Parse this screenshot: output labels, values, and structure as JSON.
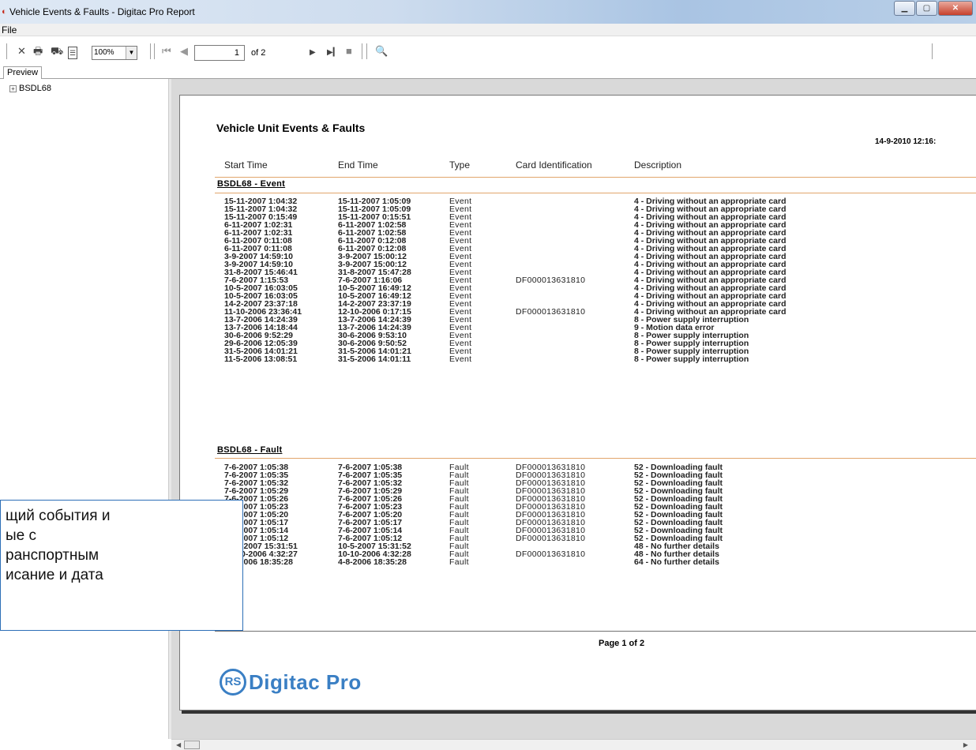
{
  "window": {
    "title": "Vehicle Events & Faults - Digitac Pro Report"
  },
  "menu": {
    "file": "File"
  },
  "toolbar": {
    "zoom": "100%",
    "page_current": "1",
    "page_of": "of 2"
  },
  "tabs": {
    "preview": "Preview"
  },
  "tree": {
    "root": "BSDL68"
  },
  "report": {
    "title": "Vehicle Unit Events & Faults",
    "date": "14-9-2010  12:16:",
    "headers": {
      "start": "Start Time",
      "end": "End Time",
      "type": "Type",
      "card": "Card Identification",
      "description": "Description"
    },
    "events_section": "BSDL68 - Event",
    "events": [
      [
        "15-11-2007  1:04:32",
        "15-11-2007  1:05:09",
        "Event",
        "",
        "4 - Driving without an appropriate card"
      ],
      [
        "15-11-2007  1:04:32",
        "15-11-2007  1:05:09",
        "Event",
        "",
        "4 - Driving without an appropriate card"
      ],
      [
        "15-11-2007  0:15:49",
        "15-11-2007  0:15:51",
        "Event",
        "",
        "4 - Driving without an appropriate card"
      ],
      [
        "6-11-2007  1:02:31",
        "6-11-2007  1:02:58",
        "Event",
        "",
        "4 - Driving without an appropriate card"
      ],
      [
        "6-11-2007  1:02:31",
        "6-11-2007  1:02:58",
        "Event",
        "",
        "4 - Driving without an appropriate card"
      ],
      [
        "6-11-2007  0:11:08",
        "6-11-2007  0:12:08",
        "Event",
        "",
        "4 - Driving without an appropriate card"
      ],
      [
        "6-11-2007  0:11:08",
        "6-11-2007  0:12:08",
        "Event",
        "",
        "4 - Driving without an appropriate card"
      ],
      [
        "3-9-2007 14:59:10",
        "3-9-2007 15:00:12",
        "Event",
        "",
        "4 - Driving without an appropriate card"
      ],
      [
        "3-9-2007 14:59:10",
        "3-9-2007 15:00:12",
        "Event",
        "",
        "4 - Driving without an appropriate card"
      ],
      [
        "31-8-2007 15:46:41",
        "31-8-2007 15:47:28",
        "Event",
        "",
        "4 - Driving without an appropriate card"
      ],
      [
        "7-6-2007  1:15:53",
        "7-6-2007  1:16:06",
        "Event",
        "DF000013631810",
        "4 - Driving without an appropriate card"
      ],
      [
        "10-5-2007 16:03:05",
        "10-5-2007 16:49:12",
        "Event",
        "",
        "4 - Driving without an appropriate card"
      ],
      [
        "10-5-2007 16:03:05",
        "10-5-2007 16:49:12",
        "Event",
        "",
        "4 - Driving without an appropriate card"
      ],
      [
        "14-2-2007 23:37:18",
        "14-2-2007 23:37:19",
        "Event",
        "",
        "4 - Driving without an appropriate card"
      ],
      [
        "11-10-2006 23:36:41",
        "12-10-2006  0:17:15",
        "Event",
        "DF000013631810",
        "4 - Driving without an appropriate card"
      ],
      [
        "13-7-2006 14:24:39",
        "13-7-2006 14:24:39",
        "Event",
        "",
        "8 - Power supply interruption"
      ],
      [
        "13-7-2006 14:18:44",
        "13-7-2006 14:24:39",
        "Event",
        "",
        "9 - Motion data error"
      ],
      [
        "30-6-2006  9:52:29",
        "30-6-2006  9:53:10",
        "Event",
        "",
        "8 - Power supply interruption"
      ],
      [
        "29-6-2006 12:05:39",
        "30-6-2006  9:50:52",
        "Event",
        "",
        "8 - Power supply interruption"
      ],
      [
        "31-5-2006 14:01:21",
        "31-5-2006 14:01:21",
        "Event",
        "",
        "8 - Power supply interruption"
      ],
      [
        "11-5-2006 13:08:51",
        "31-5-2006 14:01:11",
        "Event",
        "",
        "8 - Power supply interruption"
      ]
    ],
    "faults_section": "BSDL68 - Fault",
    "faults": [
      [
        "7-6-2007  1:05:38",
        "7-6-2007  1:05:38",
        "Fault",
        "DF000013631810",
        "52 - Downloading fault"
      ],
      [
        "7-6-2007  1:05:35",
        "7-6-2007  1:05:35",
        "Fault",
        "DF000013631810",
        "52 - Downloading fault"
      ],
      [
        "7-6-2007  1:05:32",
        "7-6-2007  1:05:32",
        "Fault",
        "DF000013631810",
        "52 - Downloading fault"
      ],
      [
        "7-6-2007  1:05:29",
        "7-6-2007  1:05:29",
        "Fault",
        "DF000013631810",
        "52 - Downloading fault"
      ],
      [
        "7-6-2007  1:05:26",
        "7-6-2007  1:05:26",
        "Fault",
        "DF000013631810",
        "52 - Downloading fault"
      ],
      [
        "7-6-2007  1:05:23",
        "7-6-2007  1:05:23",
        "Fault",
        "DF000013631810",
        "52 - Downloading fault"
      ],
      [
        "7-6-2007  1:05:20",
        "7-6-2007  1:05:20",
        "Fault",
        "DF000013631810",
        "52 - Downloading fault"
      ],
      [
        "7-6-2007  1:05:17",
        "7-6-2007  1:05:17",
        "Fault",
        "DF000013631810",
        "52 - Downloading fault"
      ],
      [
        "7-6-2007  1:05:14",
        "7-6-2007  1:05:14",
        "Fault",
        "DF000013631810",
        "52 - Downloading fault"
      ],
      [
        "7-6-2007  1:05:12",
        "7-6-2007  1:05:12",
        "Fault",
        "DF000013631810",
        "52 - Downloading fault"
      ],
      [
        "10-5-2007 15:31:51",
        "10-5-2007 15:31:52",
        "Fault",
        "",
        "48 - No further details"
      ],
      [
        "10-10-2006  4:32:27",
        "10-10-2006  4:32:28",
        "Fault",
        "DF000013631810",
        "48 - No further details"
      ],
      [
        "4-8-2006 18:35:28",
        "4-8-2006 18:35:28",
        "Fault",
        "",
        "64 - No further details"
      ]
    ],
    "footer": "Page 1 of 2",
    "logo_text": "Digitac Pro"
  },
  "callout": {
    "lines": [
      "щий события и",
      "ые с",
      "ранспортным",
      "исание и дата"
    ]
  },
  "colors": {
    "accent": "#3a7fc4",
    "rule": "#e1a66c"
  }
}
